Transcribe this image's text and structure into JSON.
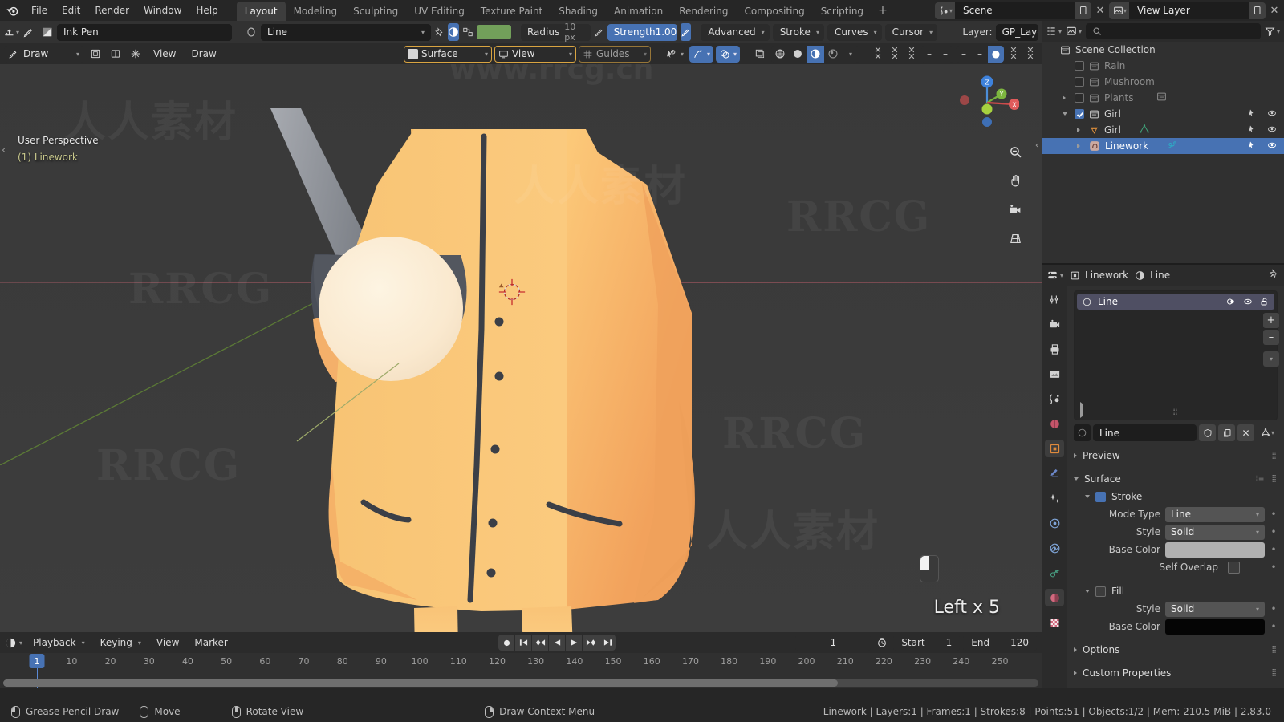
{
  "app": {
    "title": "Blender",
    "version": "2.83.0"
  },
  "topbar": {
    "menus": [
      "File",
      "Edit",
      "Render",
      "Window",
      "Help"
    ],
    "workspaces": [
      "Layout",
      "Modeling",
      "Sculpting",
      "UV Editing",
      "Texture Paint",
      "Shading",
      "Animation",
      "Rendering",
      "Compositing",
      "Scripting"
    ],
    "active_workspace": "Layout",
    "add_workspace": "+",
    "scene_label": "Scene",
    "view_layer_label": "View Layer"
  },
  "tool_header": {
    "brush_name": "Ink Pen",
    "material_name": "Line",
    "radius_label": "Radius",
    "radius_value": "10 px",
    "strength_label": "Strength",
    "strength_value": "1.000",
    "advanced_label": "Advanced",
    "stroke_label": "Stroke",
    "curves_label": "Curves",
    "cursor_label": "Cursor",
    "layer_label": "Layer:",
    "layer_value": "GP_Layer",
    "brush_color": "#72a05a"
  },
  "viewport_header": {
    "mode": "Draw",
    "menus": [
      "View",
      "Draw"
    ],
    "placement_label": "Surface",
    "orientation_label": "View",
    "guides_label": "Guides"
  },
  "viewport": {
    "perspective_text": "User Perspective",
    "object_text": "(1) Linework",
    "hint_text": "Left x 5",
    "gizmo_axes": [
      "Z",
      "Y",
      "X"
    ]
  },
  "outliner": {
    "search_placeholder": "",
    "rows": [
      {
        "label": "Scene Collection",
        "indent": 0,
        "checkbox": null,
        "selected": false,
        "dim": false,
        "expand": null
      },
      {
        "label": "Rain",
        "indent": 1,
        "checkbox": false,
        "selected": false,
        "dim": true,
        "expand": null
      },
      {
        "label": "Mushroom",
        "indent": 1,
        "checkbox": false,
        "selected": false,
        "dim": true,
        "expand": null
      },
      {
        "label": "Plants",
        "indent": 1,
        "checkbox": false,
        "selected": false,
        "dim": true,
        "expand": "right"
      },
      {
        "label": "Girl",
        "indent": 1,
        "checkbox": true,
        "selected": false,
        "dim": false,
        "expand": "down"
      },
      {
        "label": "Girl",
        "indent": 2,
        "checkbox": null,
        "selected": false,
        "dim": false,
        "expand": "right"
      },
      {
        "label": "Linework",
        "indent": 2,
        "checkbox": null,
        "selected": true,
        "dim": false,
        "expand": "right"
      }
    ]
  },
  "properties": {
    "breadcrumb_object": "Linework",
    "breadcrumb_material": "Line",
    "material_slot": "Line",
    "material_name_field": "Line",
    "panels": {
      "preview": "Preview",
      "surface": "Surface",
      "options": "Options",
      "custom_properties": "Custom Properties"
    },
    "stroke": {
      "title": "Stroke",
      "enabled": true,
      "mode_type_label": "Mode Type",
      "mode_type_value": "Line",
      "style_label": "Style",
      "style_value": "Solid",
      "base_color_label": "Base Color",
      "base_color_value": "#b0b0b0",
      "self_overlap_label": "Self Overlap",
      "self_overlap_enabled": false
    },
    "fill": {
      "title": "Fill",
      "enabled": false,
      "style_label": "Style",
      "style_value": "Solid",
      "base_color_label": "Base Color",
      "base_color_value": "#050505"
    }
  },
  "timeline": {
    "menus": [
      "Playback",
      "Keying",
      "View",
      "Marker"
    ],
    "current_frame": "1",
    "start_label": "Start",
    "start_value": "1",
    "end_label": "End",
    "end_value": "120",
    "ticks": [
      10,
      20,
      30,
      40,
      50,
      60,
      70,
      80,
      90,
      100,
      110,
      120,
      130,
      140,
      150,
      160,
      170,
      180,
      190,
      200,
      210,
      220,
      230,
      240,
      250
    ]
  },
  "statusbar": {
    "hints": [
      {
        "mouse": "left",
        "label": "Grease Pencil Draw"
      },
      {
        "mouse": "move",
        "label": "Move"
      },
      {
        "mouse": "middle",
        "label": "Rotate View"
      },
      {
        "mouse": "right",
        "label": "Draw Context Menu"
      }
    ],
    "info": "Linework | Layers:1 | Frames:1 | Strokes:8 | Points:51 | Objects:1/2 | Mem: 210.5 MiB | 2.83.0"
  }
}
